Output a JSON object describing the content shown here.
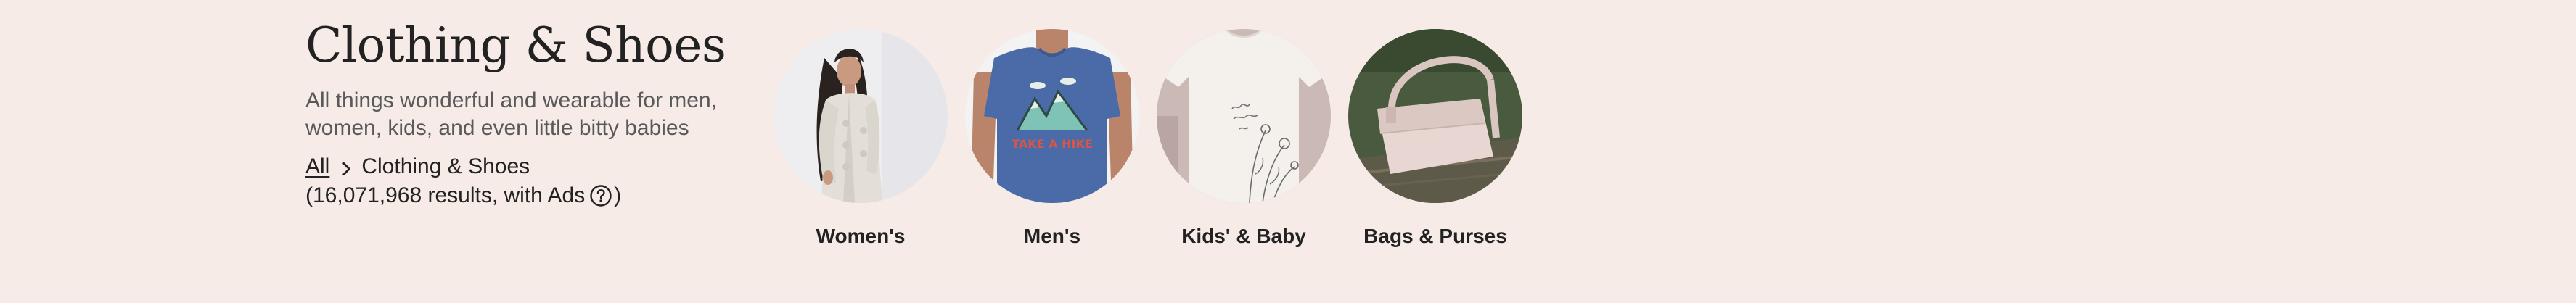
{
  "header": {
    "title": "Clothing & Shoes",
    "subtitle": "All things wonderful and wearable for men, women, kids, and even little bitty babies"
  },
  "breadcrumb": {
    "root_label": "All",
    "current_label": "Clothing & Shoes"
  },
  "results": {
    "prefix": "(16,071,968 results, with Ads",
    "suffix": ")"
  },
  "categories": [
    {
      "label": "Women's",
      "icon": "womens-clothing-photo"
    },
    {
      "label": "Men's",
      "icon": "mens-tshirt-photo",
      "shirt_text": "TAKE A HIKE"
    },
    {
      "label": "Kids' & Baby",
      "icon": "baby-onesie-photo"
    },
    {
      "label": "Bags & Purses",
      "icon": "leather-bag-photo"
    }
  ],
  "colors": {
    "background": "#f6ebe7",
    "text_primary": "#222222",
    "text_secondary": "#595959"
  }
}
